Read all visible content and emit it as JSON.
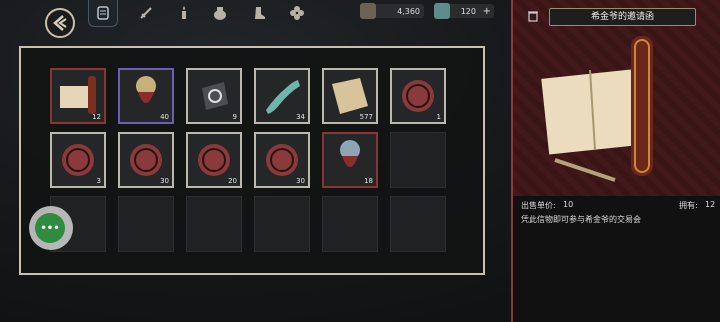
{
  "currency": {
    "gold": "4,360",
    "gems": "120"
  },
  "tabs": [
    "tab-1",
    "tab-2",
    "tab-3",
    "tab-4",
    "tab-5",
    "tab-6"
  ],
  "grid": {
    "slots": [
      {
        "qty": "12"
      },
      {
        "qty": "40"
      },
      {
        "qty": "9"
      },
      {
        "qty": "34"
      },
      {
        "qty": "577"
      },
      {
        "qty": "1"
      },
      {
        "qty": "3"
      },
      {
        "qty": "30"
      },
      {
        "qty": "20"
      },
      {
        "qty": "30"
      },
      {
        "qty": "18"
      }
    ]
  },
  "detail": {
    "title": "希金爷的邀请函",
    "price_label": "出售单价:",
    "price_value": "10",
    "owned_label": "拥有:",
    "owned_value": "12",
    "description": "凭此信物即可参与希金爷的交易会"
  },
  "fab": {
    "label": "•••"
  },
  "colors": {
    "panel_border": "#c9c2b0",
    "detail_bg": "#3a1516",
    "fab_green": "#2f8b3e"
  }
}
